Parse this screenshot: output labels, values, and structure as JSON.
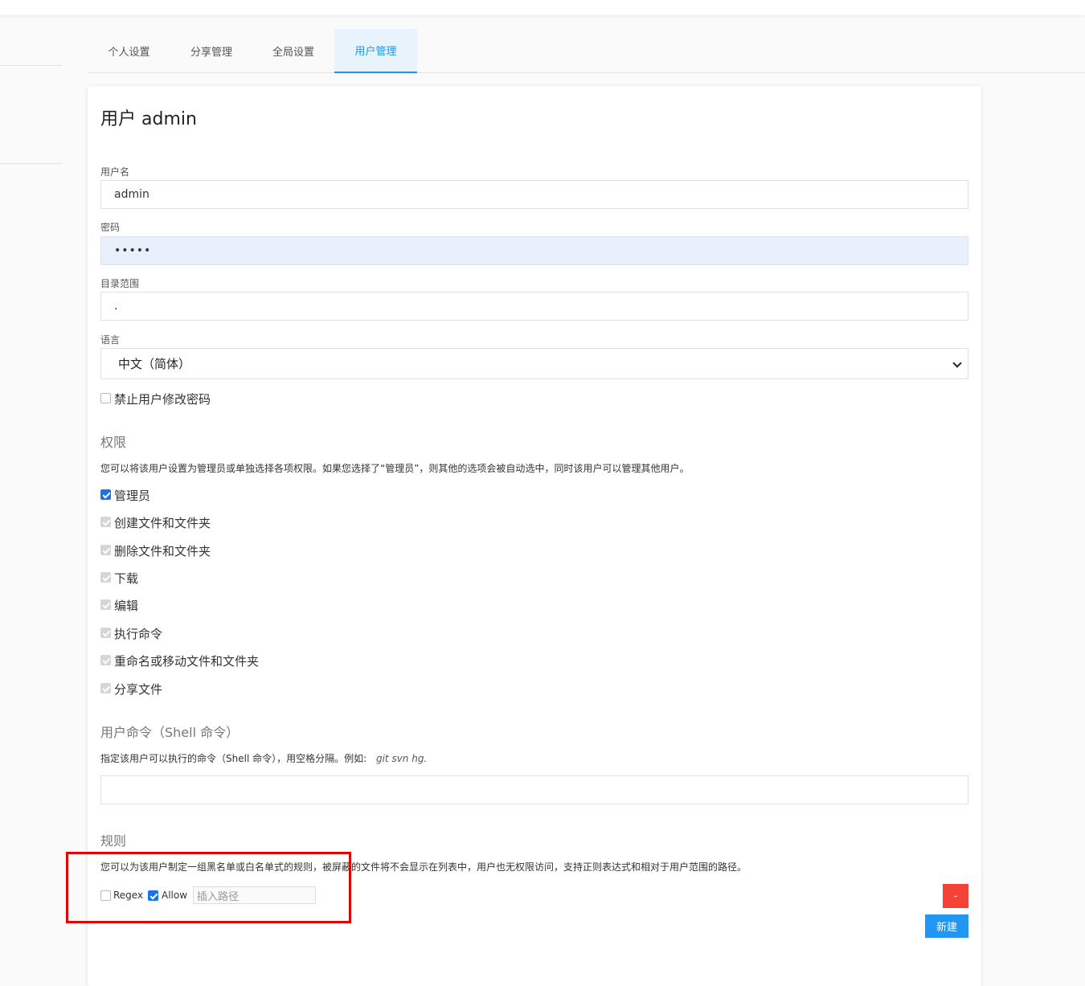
{
  "tabs": [
    {
      "label": "个人设置",
      "active": false
    },
    {
      "label": "分享管理",
      "active": false
    },
    {
      "label": "全局设置",
      "active": false
    },
    {
      "label": "用户管理",
      "active": true
    }
  ],
  "form": {
    "title": "用户 admin",
    "username_label": "用户名",
    "username_value": "admin",
    "password_label": "密码",
    "password_value": "•••••",
    "scope_label": "目录范围",
    "scope_value": ".",
    "language_label": "语言",
    "language_value": "中文（简体）",
    "lock_password_label": "禁止用户修改密码",
    "lock_password_checked": false
  },
  "permissions": {
    "title": "权限",
    "description": "您可以将该用户设置为管理员或单独选择各项权限。如果您选择了“管理员”，则其他的选项会被自动选中，同时该用户可以管理其他用户。",
    "items": [
      {
        "label": "管理员",
        "checked": true,
        "disabled": false
      },
      {
        "label": "创建文件和文件夹",
        "checked": true,
        "disabled": true
      },
      {
        "label": "删除文件和文件夹",
        "checked": true,
        "disabled": true
      },
      {
        "label": "下载",
        "checked": true,
        "disabled": true
      },
      {
        "label": "编辑",
        "checked": true,
        "disabled": true
      },
      {
        "label": "执行命令",
        "checked": true,
        "disabled": true
      },
      {
        "label": "重命名或移动文件和文件夹",
        "checked": true,
        "disabled": true
      },
      {
        "label": "分享文件",
        "checked": true,
        "disabled": true
      }
    ]
  },
  "commands": {
    "title": "用户命令（Shell 命令）",
    "description": "指定该用户可以执行的命令（Shell 命令），用空格分隔。例如:",
    "example": "git svn hg.",
    "value": ""
  },
  "rules": {
    "title": "规则",
    "description": "您可以为该用户制定一组黑名单或白名单式的规则，被屏蔽的文件将不会显示在列表中，用户也无权限访问，支持正则表达式和相对于用户范围的路径。",
    "regex_label": "Regex",
    "regex_checked": false,
    "allow_label": "Allow",
    "allow_checked": true,
    "path_placeholder": "插入路径",
    "remove_label": "-",
    "new_label": "新建"
  },
  "colors": {
    "accent": "#2196f3",
    "danger": "#f44336",
    "highlight_box": "#e00000"
  }
}
